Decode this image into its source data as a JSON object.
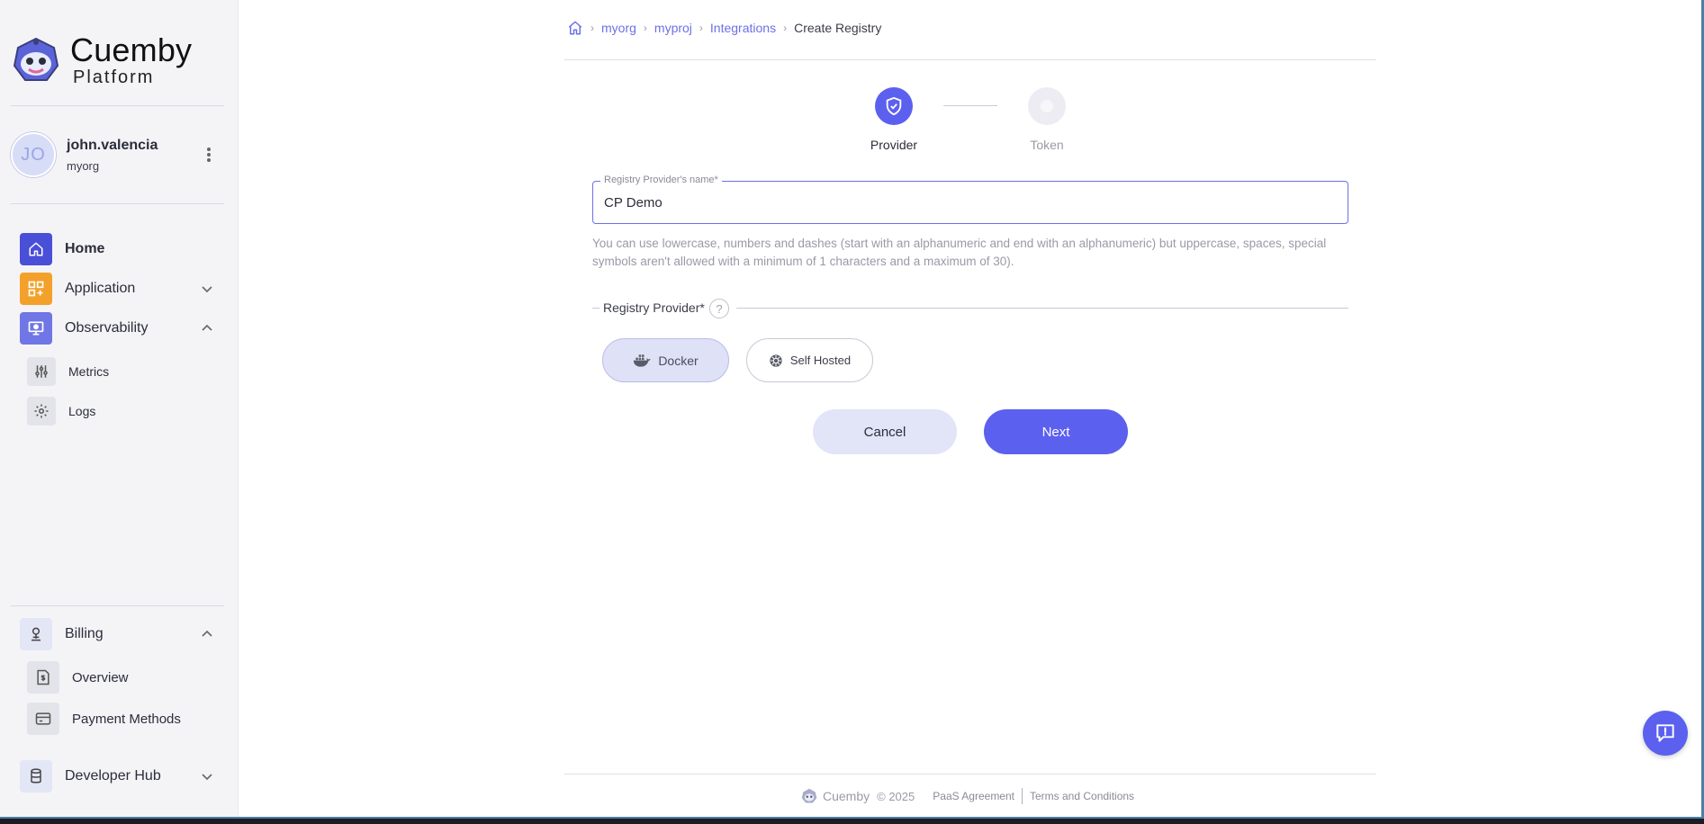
{
  "brand": {
    "name": "Cuemby",
    "sub": "Platform"
  },
  "user": {
    "initials": "JO",
    "name": "john.valencia",
    "org": "myorg"
  },
  "sidebar": {
    "nav": [
      {
        "label": "Home",
        "icon": "home-icon"
      },
      {
        "label": "Application",
        "icon": "apps-icon"
      },
      {
        "label": "Observability",
        "icon": "monitor-icon"
      }
    ],
    "observability_items": [
      {
        "label": "Metrics",
        "icon": "sliders-icon"
      },
      {
        "label": "Logs",
        "icon": "gear-icon"
      }
    ],
    "billing": {
      "label": "Billing",
      "icon": "billing-icon"
    },
    "billing_items": [
      {
        "label": "Overview",
        "icon": "invoice-icon"
      },
      {
        "label": "Payment Methods",
        "icon": "card-icon"
      }
    ],
    "developer_hub": {
      "label": "Developer Hub",
      "icon": "database-icon"
    }
  },
  "breadcrumb": {
    "items": [
      "myorg",
      "myproj",
      "Integrations"
    ],
    "current": "Create Registry"
  },
  "stepper": {
    "steps": [
      {
        "label": "Provider",
        "state": "active"
      },
      {
        "label": "Token",
        "state": "inactive"
      }
    ]
  },
  "form": {
    "name_label": "Registry Provider's name*",
    "name_value": "CP Demo",
    "help_text": "You can use lowercase, numbers and dashes (start with an alphanumeric and end with an alphanumeric) but uppercase, spaces, special symbols aren't allowed with a minimum of 1 characters and a maximum of 30).",
    "provider_label": "Registry Provider*",
    "help_icon": "?",
    "providers": [
      {
        "label": "Docker",
        "selected": true,
        "icon": "docker-icon"
      },
      {
        "label": "Self Hosted",
        "selected": false,
        "icon": "helm-icon"
      }
    ],
    "cancel_label": "Cancel",
    "next_label": "Next"
  },
  "footer": {
    "brand": "Cuemby",
    "copyright": "© 2025",
    "links": [
      "PaaS Agreement",
      "Terms and Conditions"
    ]
  },
  "colors": {
    "accent": "#5c60ef",
    "sidebar_bg": "#f4f4f7",
    "home_icon_bg": "#4a4fd8",
    "application_icon_bg": "#f3a12b",
    "observability_icon_bg": "#7076e6"
  }
}
